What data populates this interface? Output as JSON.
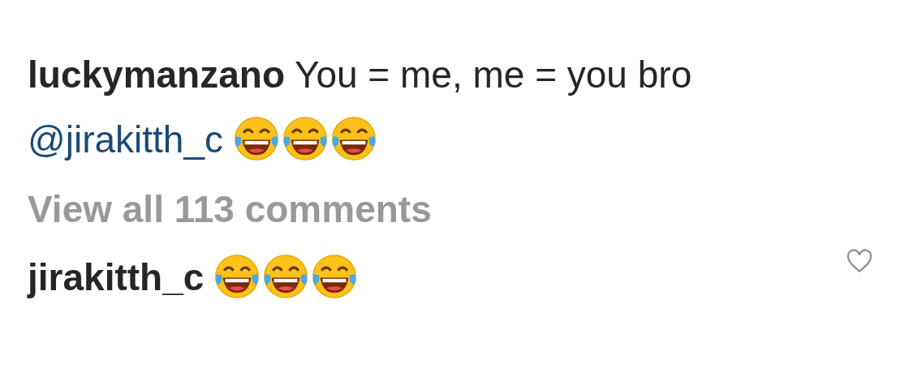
{
  "caption": {
    "username": "luckymanzano",
    "text": "You = me, me = you bro",
    "mention": "@jirakitth_c",
    "emojis": [
      {
        "kind": "tears-of-joy"
      },
      {
        "kind": "tears-of-joy"
      },
      {
        "kind": "tears-of-joy"
      }
    ]
  },
  "view_all": "View all 113 comments",
  "comments": [
    {
      "username": "jirakitth_c",
      "emojis": [
        {
          "kind": "tears-of-joy"
        },
        {
          "kind": "tears-of-joy"
        },
        {
          "kind": "tears-of-joy"
        }
      ],
      "liked": false
    }
  ]
}
